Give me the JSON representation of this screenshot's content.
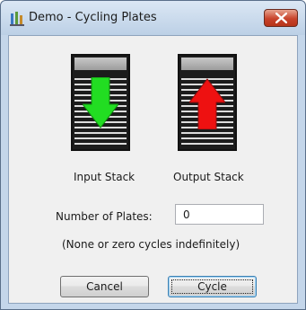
{
  "window": {
    "title": "Demo - Cycling Plates",
    "icons": {
      "app": "app-icon",
      "close": "close-icon"
    }
  },
  "stacks": {
    "input": {
      "label": "Input Stack",
      "arrow_icon": "arrow-down-icon",
      "arrow_color": "#22dd22"
    },
    "output": {
      "label": "Output Stack",
      "arrow_icon": "arrow-up-icon",
      "arrow_color": "#ee1111"
    }
  },
  "form": {
    "plates_label": "Number of Plates:",
    "plates_value": "0",
    "hint": "(None or zero cycles indefinitely)"
  },
  "buttons": {
    "cancel": "Cancel",
    "cycle": "Cycle"
  }
}
